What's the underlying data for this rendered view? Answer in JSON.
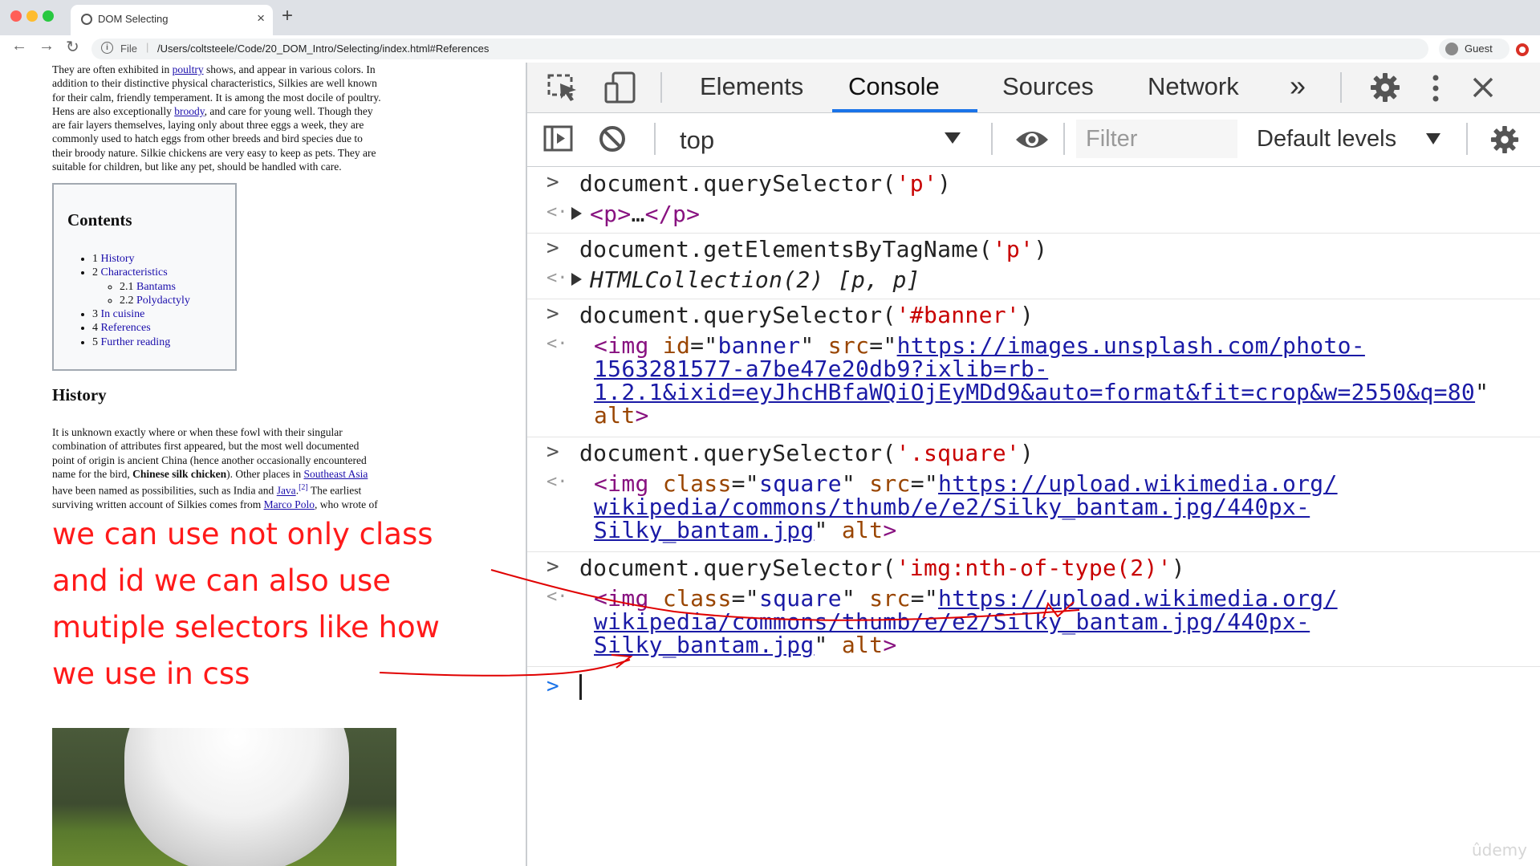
{
  "browser": {
    "tab_title": "DOM Selecting",
    "tab_close": "×",
    "new_tab": "+",
    "url_scheme_label": "File",
    "url_separator": "|",
    "url": "/Users/coltsteele/Code/20_DOM_Intro/Selecting/index.html#References",
    "profile_label": "Guest",
    "nav": {
      "back": "←",
      "forward": "→",
      "reload": "↻"
    },
    "info_glyph": "i",
    "traffic_colors": [
      "#ff5f57",
      "#febc2e",
      "#28c840"
    ]
  },
  "page": {
    "intro_lines": [
      [
        "They are often exhibited in ",
        {
          "link": "poultry"
        },
        " shows, and appear in various colors. In"
      ],
      [
        "addition to their distinctive physical characteristics, Silkies are well known"
      ],
      [
        "for their calm, friendly temperament. It is among the most docile of poultry."
      ],
      [
        "Hens are also exceptionally ",
        {
          "link": "broody"
        },
        ", and care for young well. Though they"
      ],
      [
        "are fair layers themselves, laying only about three eggs a week, they are"
      ],
      [
        "commonly used to hatch eggs from other breeds and bird species due to"
      ],
      [
        "their broody nature. Silkie chickens are very easy to keep as pets. They are"
      ],
      [
        "suitable for children, but like any pet, should be handled with care."
      ]
    ],
    "toc": {
      "title": "Contents",
      "items": [
        {
          "num": "1",
          "label": "History"
        },
        {
          "num": "2",
          "label": "Characteristics",
          "sub": [
            {
              "num": "2.1",
              "label": "Bantams"
            },
            {
              "num": "2.2",
              "label": "Polydactyly"
            }
          ]
        },
        {
          "num": "3",
          "label": "In cuisine"
        },
        {
          "num": "4",
          "label": "References"
        },
        {
          "num": "5",
          "label": "Further reading"
        }
      ]
    },
    "history_heading": "History",
    "history_lines": [
      [
        "It is unknown exactly where or when these fowl with their singular"
      ],
      [
        "combination of attributes first appeared, but the most well documented"
      ],
      [
        "point of origin is ancient China (hence another occasionally encountered"
      ],
      [
        "name for the bird, ",
        {
          "bold": "Chinese silk chicken"
        },
        "). Other places in ",
        {
          "link": "Southeast Asia"
        }
      ],
      [
        "have been named as possibilities, such as India and ",
        {
          "link": "Java"
        },
        ".",
        {
          "sup": "[2]"
        },
        " The earliest"
      ],
      [
        "surviving written account of Silkies comes from ",
        {
          "link": "Marco Polo"
        },
        ", who wrote of"
      ]
    ]
  },
  "annotation": {
    "lines": [
      "we can use not only class",
      "and id we can also use",
      "mutiple selectors like how",
      "we use in css"
    ],
    "color": "#ff1a1a"
  },
  "devtools": {
    "tabs": [
      "Elements",
      "Console",
      "Sources",
      "Network"
    ],
    "active_tab": "Console",
    "more_tabs": "»",
    "context": "top",
    "filter_placeholder": "Filter",
    "levels_label": "Default levels",
    "accent": "#1a73e8",
    "prompt_glyph": ">",
    "return_glyph": "<·",
    "entries": [
      {
        "input": [
          {
            "t": "document.querySelector("
          },
          {
            "s": "'p'"
          },
          {
            "t": ")"
          }
        ],
        "output": [
          [
            {
              "tri": true
            },
            {
              "tag": "<p>"
            },
            {
              "q": "…"
            },
            {
              "tag": "</p>"
            }
          ]
        ]
      },
      {
        "input": [
          {
            "t": "document.getElementsByTagName("
          },
          {
            "s": "'p'"
          },
          {
            "t": ")"
          }
        ],
        "output": [
          [
            {
              "tri": true
            },
            {
              "i": "HTMLCollection(2) [p, p]"
            }
          ]
        ]
      },
      {
        "input": [
          {
            "t": "document.querySelector("
          },
          {
            "s": "'#banner'"
          },
          {
            "t": ")"
          }
        ],
        "output": [
          [
            {
              "tag": "<img"
            },
            {
              "q": " "
            },
            {
              "attr": "id"
            },
            {
              "q": "=\""
            },
            {
              "val": "banner"
            },
            {
              "q": "\" "
            },
            {
              "attr": "src"
            },
            {
              "q": "=\""
            },
            {
              "link": "https://images.unsplash.com/photo-"
            }
          ],
          [
            {
              "link": "1563281577-a7be47e20db9?ixlib=rb-"
            }
          ],
          [
            {
              "link": "1.2.1&ixid=eyJhcHBfaWQiOjEyMDd9&auto=format&fit=crop&w=2550&q=80"
            },
            {
              "q": "\""
            }
          ],
          [
            {
              "attr": "alt"
            },
            {
              "tag": ">"
            }
          ]
        ]
      },
      {
        "input": [
          {
            "t": "document.querySelector("
          },
          {
            "s": "'.square'"
          },
          {
            "t": ")"
          }
        ],
        "output": [
          [
            {
              "tag": "<img"
            },
            {
              "q": " "
            },
            {
              "attr": "class"
            },
            {
              "q": "=\""
            },
            {
              "val": "square"
            },
            {
              "q": "\" "
            },
            {
              "attr": "src"
            },
            {
              "q": "=\""
            },
            {
              "link": "https://upload.wikimedia.org/"
            }
          ],
          [
            {
              "link": "wikipedia/commons/thumb/e/e2/Silky_bantam.jpg/440px-"
            }
          ],
          [
            {
              "link": "Silky_bantam.jpg"
            },
            {
              "q": "\" "
            },
            {
              "attr": "alt"
            },
            {
              "tag": ">"
            }
          ]
        ]
      },
      {
        "input": [
          {
            "t": "document.querySelector("
          },
          {
            "s": "'img:nth-of-type(2)'"
          },
          {
            "t": ")"
          }
        ],
        "output": [
          [
            {
              "tag": "<img"
            },
            {
              "q": " "
            },
            {
              "attr": "class"
            },
            {
              "q": "=\""
            },
            {
              "val": "square"
            },
            {
              "q": "\" "
            },
            {
              "attr": "src"
            },
            {
              "q": "=\""
            },
            {
              "link": "https://upload.wikimedia.org/"
            }
          ],
          [
            {
              "link": "wikipedia/commons/thumb/e/e2/Silky_bantam.jpg/440px-"
            }
          ],
          [
            {
              "link": "Silky_bantam.jpg"
            },
            {
              "q": "\" "
            },
            {
              "attr": "alt"
            },
            {
              "tag": ">"
            }
          ]
        ]
      }
    ]
  },
  "watermark": "ûdemy"
}
